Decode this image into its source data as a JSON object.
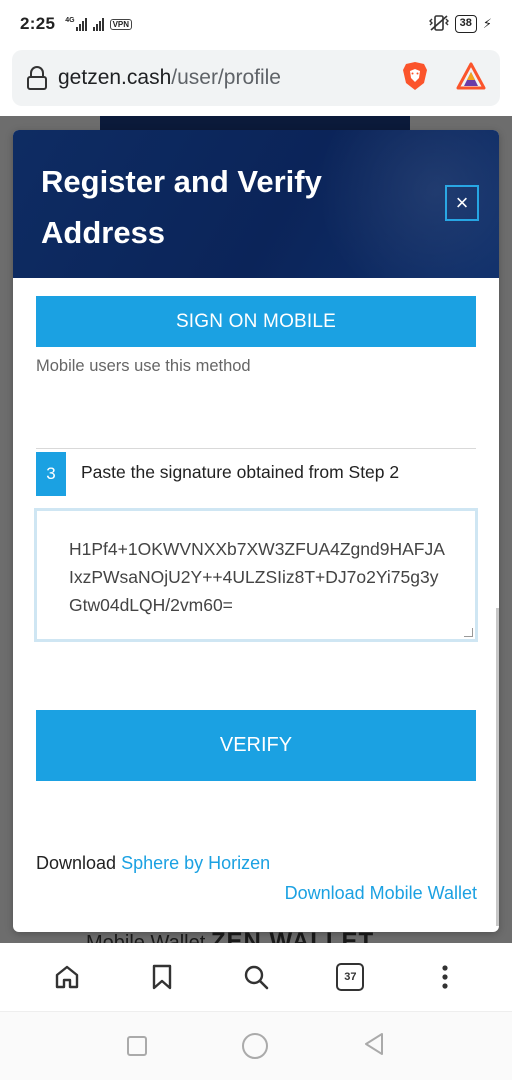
{
  "status_bar": {
    "time": "2:25",
    "network_label": "4G",
    "vpn_label": "VPN",
    "battery": "38"
  },
  "browser": {
    "url_host": "getzen.cash",
    "url_path": "/user/profile",
    "tabs_count": "37"
  },
  "modal": {
    "title": "Register and Verify Address",
    "close_label": "×",
    "sign_on_mobile_label": "SIGN ON MOBILE",
    "mobile_hint": "Mobile users use this method",
    "step_number": "3",
    "step_text": "Paste the signature obtained from Step 2",
    "signature_value": "H1Pf4+1OKWVNXXb7XW3ZFUA4Zgnd9HAFJAIxzPWsaNOjU2Y++4ULZSIiz8T+DJ7o2Yi75g3yGtw04dLQH/2vm60=",
    "verify_label": "VERIFY",
    "download_prefix": "Download ",
    "sphere_link": "Sphere by Horizen",
    "mobile_wallet_link": "Download Mobile Wallet"
  },
  "page_behind": {
    "bottom_text_prefix": "Mobile Wallet ",
    "bottom_text_brand": "ZEN WALLET"
  },
  "colors": {
    "accent": "#1ba1e2",
    "header_navy": "#0b2459",
    "brave_orange": "#fb542b"
  }
}
